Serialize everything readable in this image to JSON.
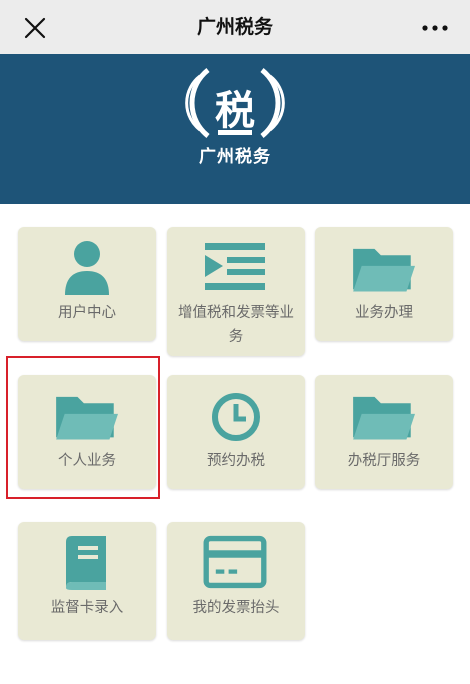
{
  "header": {
    "title": "广州税务",
    "close_icon": "close-icon",
    "more_icon": "more-dots-icon"
  },
  "banner": {
    "brand": "广州税务",
    "logo_glyph": "税",
    "background": "#1e5478"
  },
  "tiles": [
    {
      "label": "用户中心",
      "icon": "user-icon"
    },
    {
      "label": "增值税和发票等业务",
      "icon": "invoice-list-icon"
    },
    {
      "label": "业务办理",
      "icon": "folder-icon"
    },
    {
      "label": "个人业务",
      "icon": "folder-icon",
      "selected": true
    },
    {
      "label": "预约办税",
      "icon": "clock-icon"
    },
    {
      "label": "办税厅服务",
      "icon": "folder-icon"
    },
    {
      "label": "监督卡录入",
      "icon": "book-icon"
    },
    {
      "label": "我的发票抬头",
      "icon": "card-icon"
    }
  ],
  "colors": {
    "icon": "#4aa39f",
    "tile": "#e9e9d4",
    "highlight": "#d8202a"
  }
}
